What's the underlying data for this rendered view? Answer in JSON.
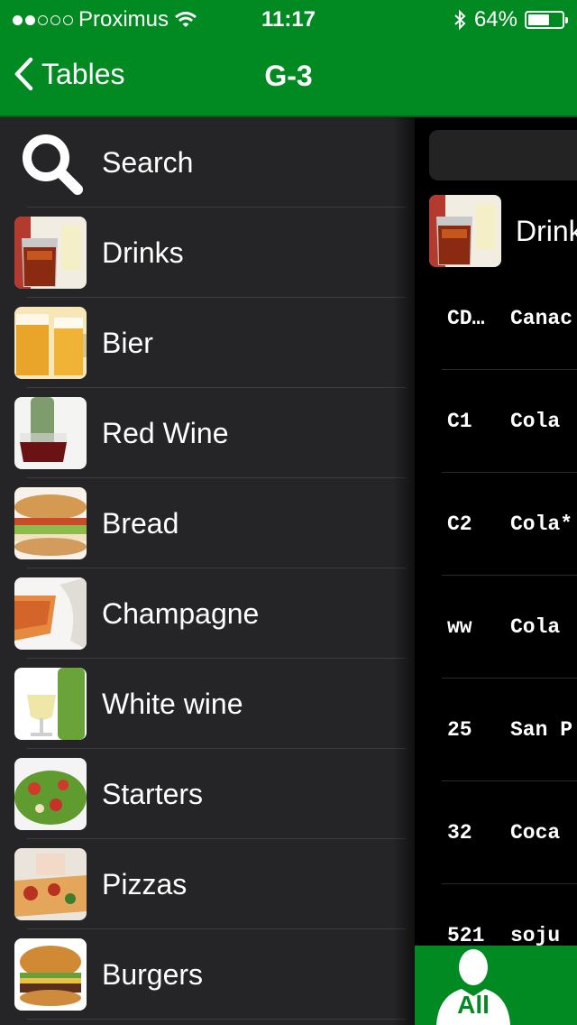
{
  "status_bar": {
    "carrier": "Proximus",
    "time": "11:17",
    "battery_percent": "64%",
    "battery_level": 0.64,
    "signal_dots_filled": 2,
    "signal_dots_total": 5
  },
  "nav": {
    "back_label": "Tables",
    "title": "G-3"
  },
  "menu": {
    "search_label": "Search",
    "categories": [
      {
        "label": "Drinks",
        "icon": "drinks-icon"
      },
      {
        "label": "Bier",
        "icon": "beer-icon"
      },
      {
        "label": "Red Wine",
        "icon": "red-wine-icon"
      },
      {
        "label": "Bread",
        "icon": "bread-icon"
      },
      {
        "label": "Champagne",
        "icon": "champagne-icon"
      },
      {
        "label": "White wine",
        "icon": "white-wine-icon"
      },
      {
        "label": "Starters",
        "icon": "starters-icon"
      },
      {
        "label": "Pizzas",
        "icon": "pizza-icon"
      },
      {
        "label": "Burgers",
        "icon": "burger-icon"
      }
    ]
  },
  "panel": {
    "title": "Drink",
    "products": [
      {
        "code": "CD…",
        "name": "Canac"
      },
      {
        "code": "C1",
        "name": "Cola"
      },
      {
        "code": "C2",
        "name": "Cola*"
      },
      {
        "code": "ww",
        "name": "Cola"
      },
      {
        "code": "25",
        "name": "San P"
      },
      {
        "code": "32",
        "name": "Coca"
      },
      {
        "code": "521",
        "name": "soju"
      }
    ],
    "all_button_label": "All"
  },
  "colors": {
    "brand_green": "#008a21",
    "menu_background": "#252426"
  }
}
